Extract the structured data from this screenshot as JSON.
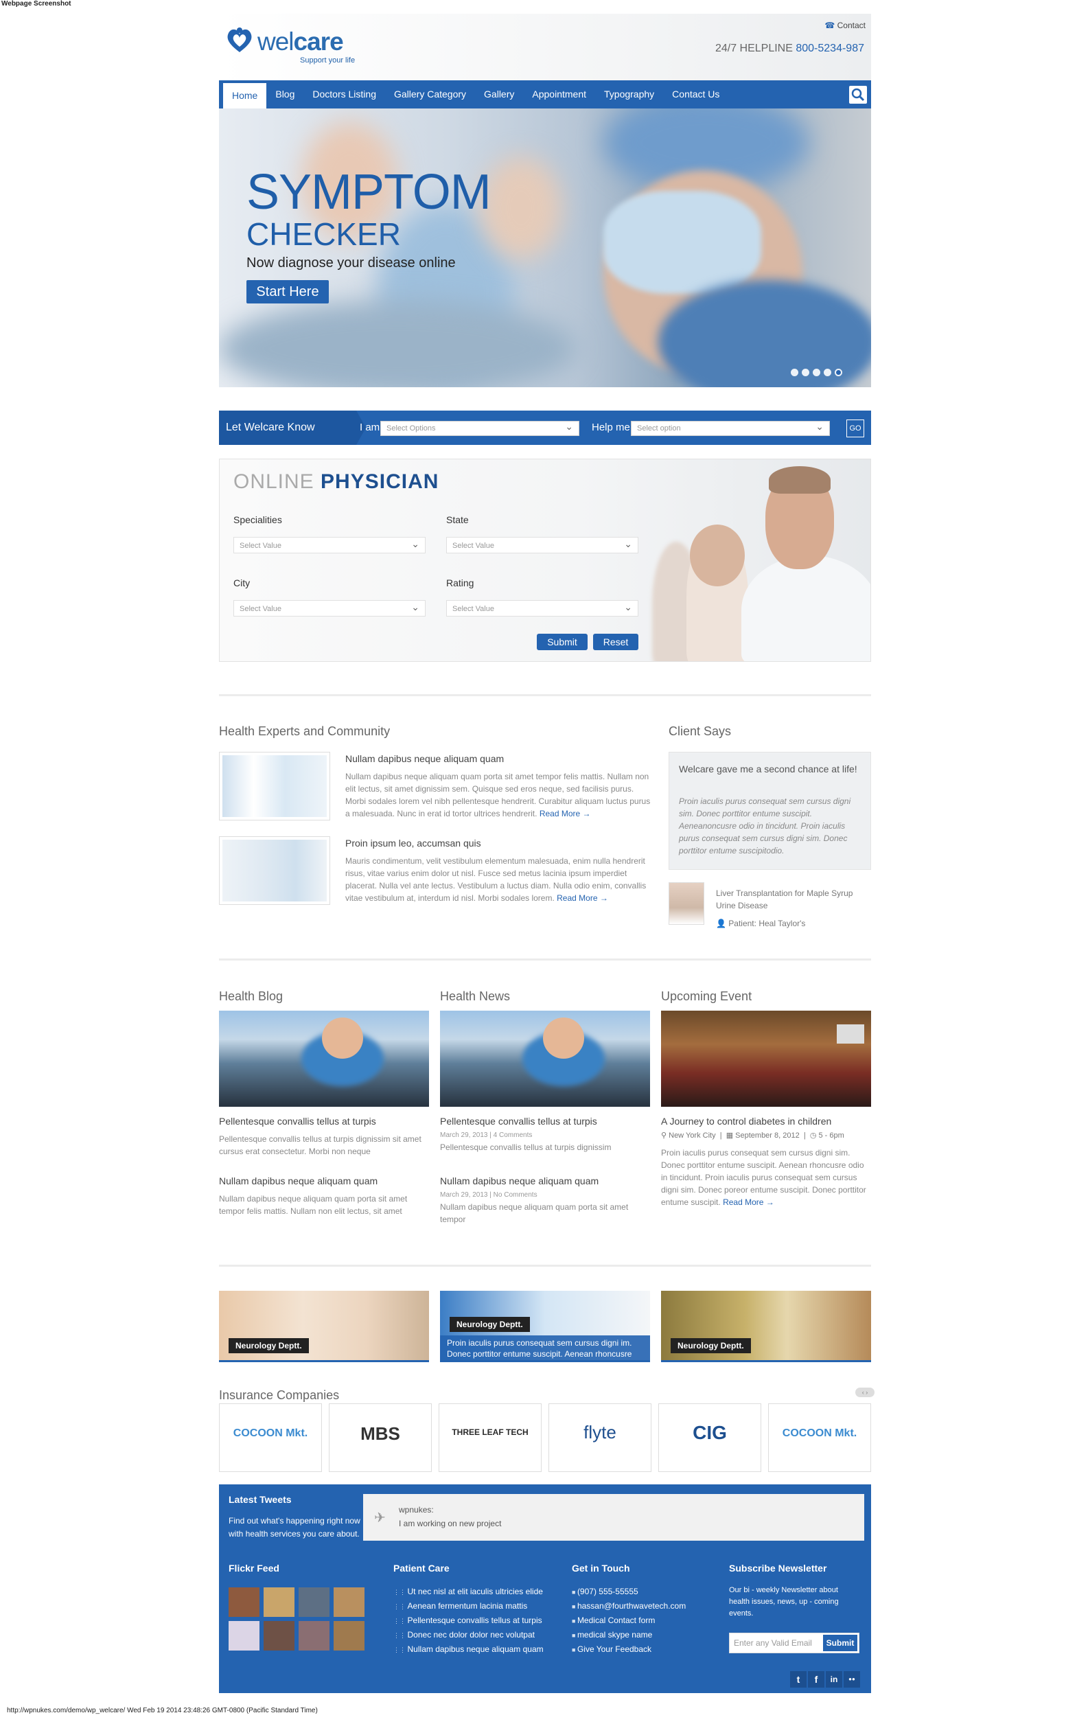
{
  "caption": "Webpage Screenshot",
  "footer_url": "http://wpnukes.com/demo/wp_welcare/ Wed Feb 19 2014 23:48:26 GMT-0800 (Pacific Standard Time)",
  "header": {
    "logo_wel": "wel",
    "logo_care": "care",
    "tagline": "Support your life",
    "contact": "Contact",
    "helpline_label": "24/7 HELPLINE",
    "helpline_number": "800-5234-987"
  },
  "nav": [
    "Home",
    "Blog",
    "Doctors Listing",
    "Gallery Category",
    "Gallery",
    "Appointment",
    "Typography",
    "Contact Us"
  ],
  "hero": {
    "title": "SYMPTOM",
    "subtitle": "CHECKER",
    "text": "Now diagnose your disease online",
    "button": "Start Here"
  },
  "know": {
    "label": "Let Welcare Know",
    "iam": "I am",
    "iam_select": "Select Options",
    "help": "Help me",
    "help_select": "Select option",
    "go": "GO"
  },
  "physician": {
    "title_light": "ONLINE",
    "title_bold": "PHYSICIAN",
    "specialities": "Specialities",
    "state": "State",
    "city": "City",
    "rating": "Rating",
    "select": "Select Value",
    "submit": "Submit",
    "reset": "Reset"
  },
  "experts": {
    "heading": "Health Experts and Community",
    "posts": [
      {
        "title": "Nullam dapibus neque aliquam quam",
        "body": "Nullam dapibus neque aliquam quam porta sit amet tempor felis mattis. Nullam non elit lectus, sit amet dignissim sem. Quisque sed eros neque, sed facilisis purus. Morbi sodales lorem vel nibh pellentesque hendrerit. Curabitur aliquam luctus purus a malesuada. Nunc in erat id tortor ultrices hendrerit.",
        "more": "Read More →"
      },
      {
        "title": "Proin ipsum leo, accumsan quis",
        "body": "Mauris condimentum, velit vestibulum elementum malesuada, enim nulla hendrerit risus, vitae varius enim dolor ut nisl. Fusce sed metus lacinia ipsum imperdiet placerat. Nulla vel ante lectus. Vestibulum a luctus diam. Nulla odio enim, convallis vitae vestibulum at, interdum id nisl. Morbi sodales lorem.",
        "more": "Read More →"
      }
    ]
  },
  "client": {
    "heading": "Client Says",
    "quote_title": "Welcare gave me a second chance at life!",
    "quote": "Proin iaculis purus consequat sem cursus digni sim. Donec porttitor entume suscipit. Aeneanoncusre odio in tincidunt. Proin iaculis purus consequat sem cursus digni sim. Donec porttitor entume suscipitodio.",
    "case": "Liver Transplantation for Maple Syrup Urine Disease",
    "patient_label": "Patient:",
    "patient": "Heal Taylor's"
  },
  "blog": {
    "heading": "Health Blog",
    "items": [
      {
        "title": "Pellentesque convallis tellus at turpis",
        "body": "Pellentesque convallis tellus at turpis dignissim sit amet cursus erat consectetur. Morbi non neque"
      },
      {
        "title": "Nullam dapibus neque aliquam quam",
        "body": "Nullam dapibus neque aliquam quam porta sit amet tempor felis mattis. Nullam non elit lectus, sit amet"
      }
    ]
  },
  "news": {
    "heading": "Health News",
    "items": [
      {
        "title": "Pellentesque convallis tellus at turpis",
        "date": "March 29, 2013",
        "comments": "4 Comments",
        "body": "Pellentesque convallis tellus at turpis dignissim"
      },
      {
        "title": "Nullam dapibus neque aliquam quam",
        "date": "March 29, 2013",
        "comments": "No Comments",
        "body": "Nullam dapibus neque aliquam quam porta sit amet tempor"
      }
    ]
  },
  "event": {
    "heading": "Upcoming Event",
    "title": "A Journey to control diabetes in children",
    "location": "New York City",
    "date": "September 8, 2012",
    "time": "5 - 6pm",
    "body": "Proin iaculis purus consequat sem cursus digni sim. Donec porttitor entume suscipit. Aenean rhoncusre odio in tincidunt. Proin iaculis purus consequat sem cursus digni sim. Donec poreor entume suscipit. Donec porttitor entume suscipit.",
    "more": "Read More →"
  },
  "depts": {
    "label": "Neurology Deptt.",
    "middle_text": "Proin iaculis purus consequat sem cursus digni im. Donec porttitor entume suscipit. Aenean rhoncusre"
  },
  "insurance": {
    "heading": "Insurance Companies",
    "logos": [
      "COCOON Mkt.",
      "MBS",
      "THREE LEAF TECH",
      "flyte",
      "CIG",
      "COCOON Mkt."
    ]
  },
  "footer": {
    "tweets_heading": "Latest Tweets",
    "tweets_text": "Find out what's happening right now with health services you care about.",
    "tweet_user": "wpnukes:",
    "tweet_text": "I am working on new project",
    "flickr": "Flickr Feed",
    "patient_heading": "Patient Care",
    "patient_links": [
      "Ut nec nisl at elit iaculis ultricies elide",
      "Aenean fermentum lacinia mattis",
      "Pellentesque convallis tellus at turpis",
      "Donec nec dolor dolor nec volutpat",
      "Nullam dapibus neque aliquam quam"
    ],
    "touch_heading": "Get in Touch",
    "touch": [
      "(907) 555-55555",
      "hassan@fourthwavetech.com",
      "Medical Contact form",
      "medical skype name",
      "Give Your Feedback"
    ],
    "news_heading": "Subscribe Newsletter",
    "news_text": "Our bi - weekly Newsletter about health issues, news, up - coming events.",
    "news_placeholder": "Enter any Valid Email",
    "news_submit": "Submit",
    "social": [
      "t",
      "f",
      "in",
      "●●"
    ]
  }
}
